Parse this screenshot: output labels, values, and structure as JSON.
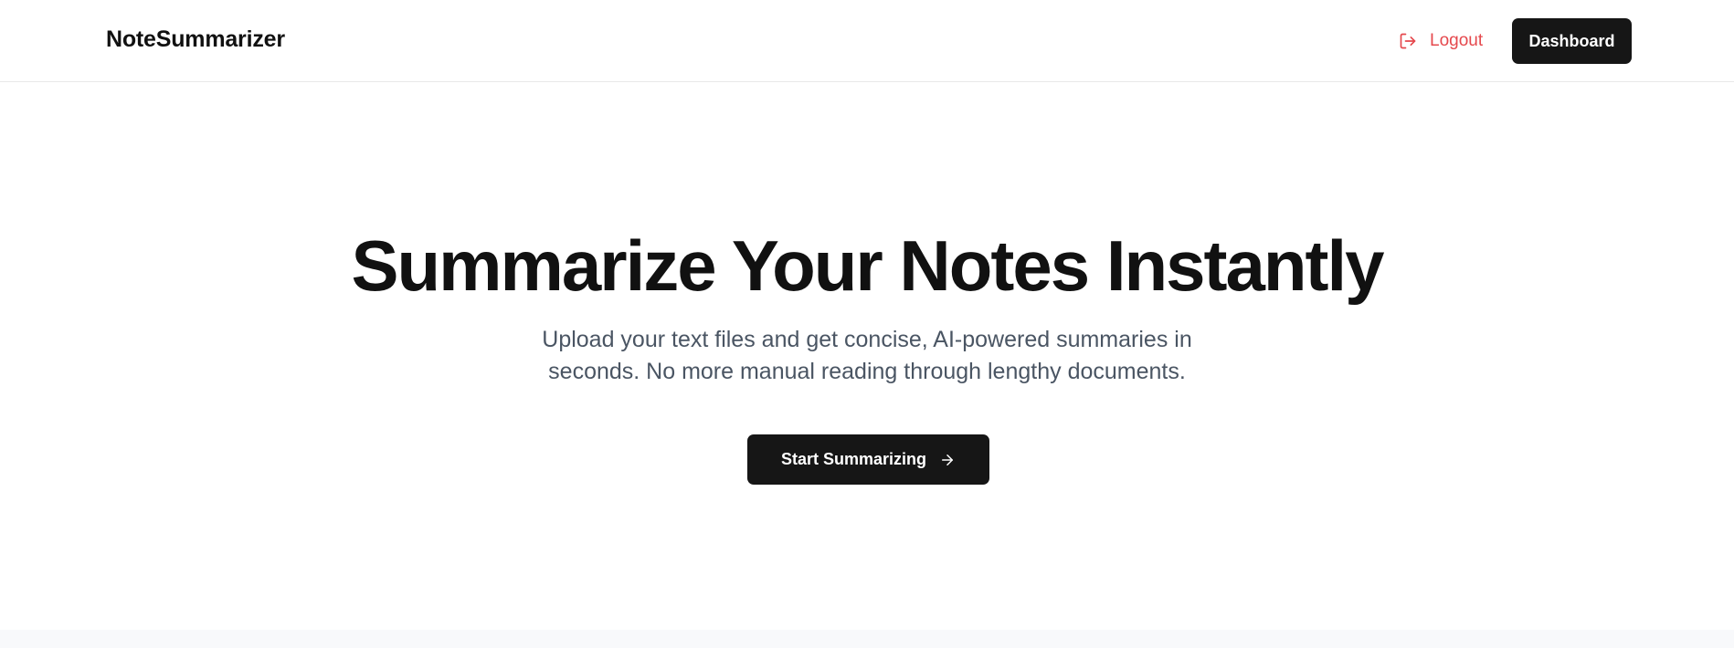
{
  "header": {
    "brand": "NoteSummarizer",
    "logout_label": "Logout",
    "dashboard_label": "Dashboard"
  },
  "hero": {
    "title": "Summarize Your Notes Instantly",
    "subtitle": "Upload your text files and get concise, AI-powered summaries in seconds. No more manual reading through lengthy documents.",
    "cta_label": "Start Summarizing"
  },
  "icons": {
    "logout": "logout-icon",
    "cta_arrow": "arrow-right-icon"
  },
  "colors": {
    "logout_accent": "#e5484d",
    "primary_button": "#161616",
    "subtitle_text": "#4a5563"
  }
}
